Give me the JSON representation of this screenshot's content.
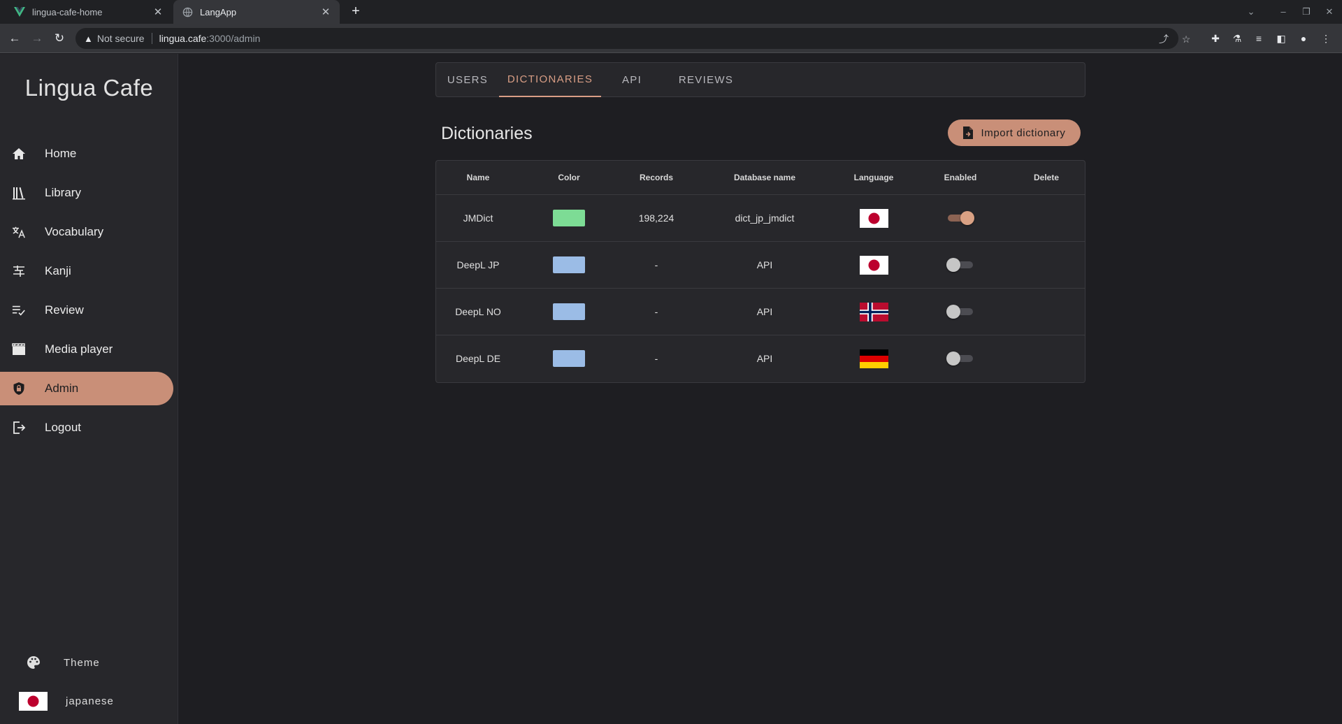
{
  "browser": {
    "tabs": [
      {
        "title": "lingua-cafe-home",
        "favicon": "vue-logo-icon",
        "active": false
      },
      {
        "title": "LangApp",
        "favicon": "globe-icon",
        "active": true
      }
    ],
    "address": {
      "security_label": "Not secure",
      "host": "lingua.cafe",
      "path": ":3000/admin"
    }
  },
  "sidebar": {
    "brand": "Lingua Cafe",
    "items": [
      {
        "label": "Home",
        "icon": "home-icon"
      },
      {
        "label": "Library",
        "icon": "library-icon"
      },
      {
        "label": "Vocabulary",
        "icon": "translate-icon"
      },
      {
        "label": "Kanji",
        "icon": "kanji-icon"
      },
      {
        "label": "Review",
        "icon": "review-list-icon"
      },
      {
        "label": "Media player",
        "icon": "movie-icon"
      },
      {
        "label": "Admin",
        "icon": "shield-lock-icon",
        "active": true
      },
      {
        "label": "Logout",
        "icon": "logout-icon"
      }
    ],
    "theme_label": "Theme",
    "language_label": "japanese"
  },
  "admin": {
    "tabs": [
      "USERS",
      "DICTIONARIES",
      "API",
      "REVIEWS"
    ],
    "active_tab": "DICTIONARIES",
    "page_title": "Dictionaries",
    "import_button": "Import dictionary",
    "table": {
      "headers": [
        "Name",
        "Color",
        "Records",
        "Database name",
        "Language",
        "Enabled",
        "Delete"
      ],
      "rows": [
        {
          "name": "JMDict",
          "color": "#7ddc95",
          "records": "198,224",
          "database": "dict_jp_jmdict",
          "flag": "japan",
          "enabled": true
        },
        {
          "name": "DeepL JP",
          "color": "#9bbce6",
          "records": "-",
          "database": "API",
          "flag": "japan",
          "enabled": false
        },
        {
          "name": "DeepL NO",
          "color": "#9bbce6",
          "records": "-",
          "database": "API",
          "flag": "norway",
          "enabled": false
        },
        {
          "name": "DeepL DE",
          "color": "#9bbce6",
          "records": "-",
          "database": "API",
          "flag": "germany",
          "enabled": false
        }
      ]
    }
  },
  "colors": {
    "accent": "#c98f78",
    "background": "#1e1e22",
    "surface": "#27272b"
  }
}
